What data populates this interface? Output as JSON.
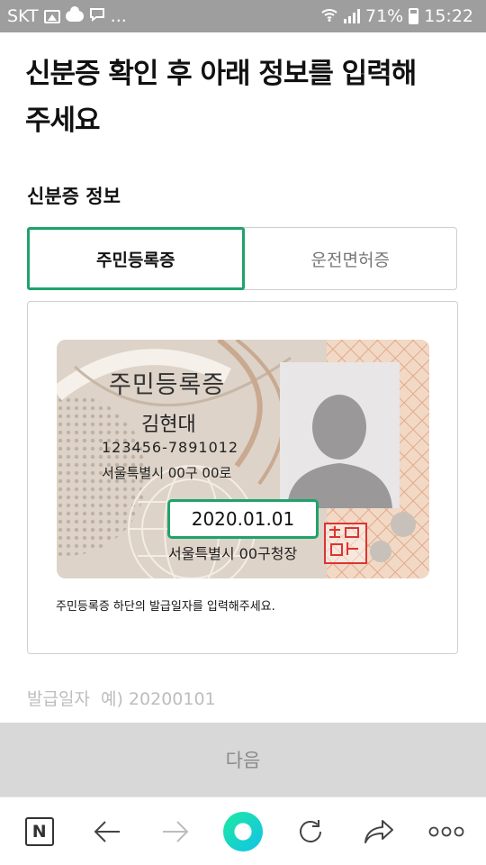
{
  "status_bar": {
    "carrier": "SKT",
    "more": "...",
    "battery": "71%",
    "time": "15:22",
    "icons": [
      "image-icon",
      "cloud-icon",
      "chat-icon",
      "wifi-icon",
      "signal-icon",
      "battery-icon"
    ]
  },
  "header": {
    "title_line1": "신분증 확인 후 아래 정보를 입력해",
    "title_line2": "주세요"
  },
  "id_section": {
    "label": "신분증 정보",
    "tabs": [
      {
        "label": "주민등록증",
        "selected": true
      },
      {
        "label": "운전면허증",
        "selected": false
      }
    ]
  },
  "id_card": {
    "title": "주민등록증",
    "name": "김현대",
    "number": "123456-7891012",
    "address": "서울특별시 00구 00로",
    "issue_date": "2020.01.01",
    "issuer": "서울특별시 00구청장"
  },
  "instruction": "주민등록증 하단의 발급일자를 입력해주세요.",
  "issue_date_field": {
    "placeholder": "발급일자  예) 20200101",
    "value": ""
  },
  "next_button": "다음",
  "browser_bar": {
    "items": [
      "n-logo-icon",
      "back-icon",
      "forward-icon",
      "home-icon",
      "refresh-icon",
      "share-icon",
      "more-icon"
    ],
    "logo_letter": "N"
  },
  "colors": {
    "accent": "#1fa36a",
    "status_bar": "#9e9e9e",
    "button_disabled": "#d8d8d8"
  }
}
